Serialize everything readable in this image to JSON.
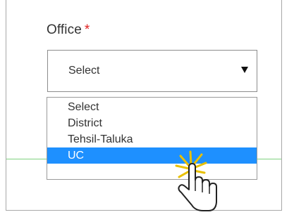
{
  "form": {
    "field_label": "Office",
    "required_marker": "*",
    "select": {
      "current_value": "Select"
    },
    "dropdown": {
      "options": [
        {
          "label": "Select",
          "highlighted": false
        },
        {
          "label": "District",
          "highlighted": false
        },
        {
          "label": "Tehsil-Taluka",
          "highlighted": false
        },
        {
          "label": "UC",
          "highlighted": true
        }
      ]
    }
  },
  "colors": {
    "highlight": "#1e90ff",
    "required": "#e02020",
    "divider": "#7fd17f",
    "cursor_burst": "#e8c000"
  },
  "icons": {
    "select_arrow": "triangle-down",
    "pointer": "hand-pointer-cursor"
  }
}
